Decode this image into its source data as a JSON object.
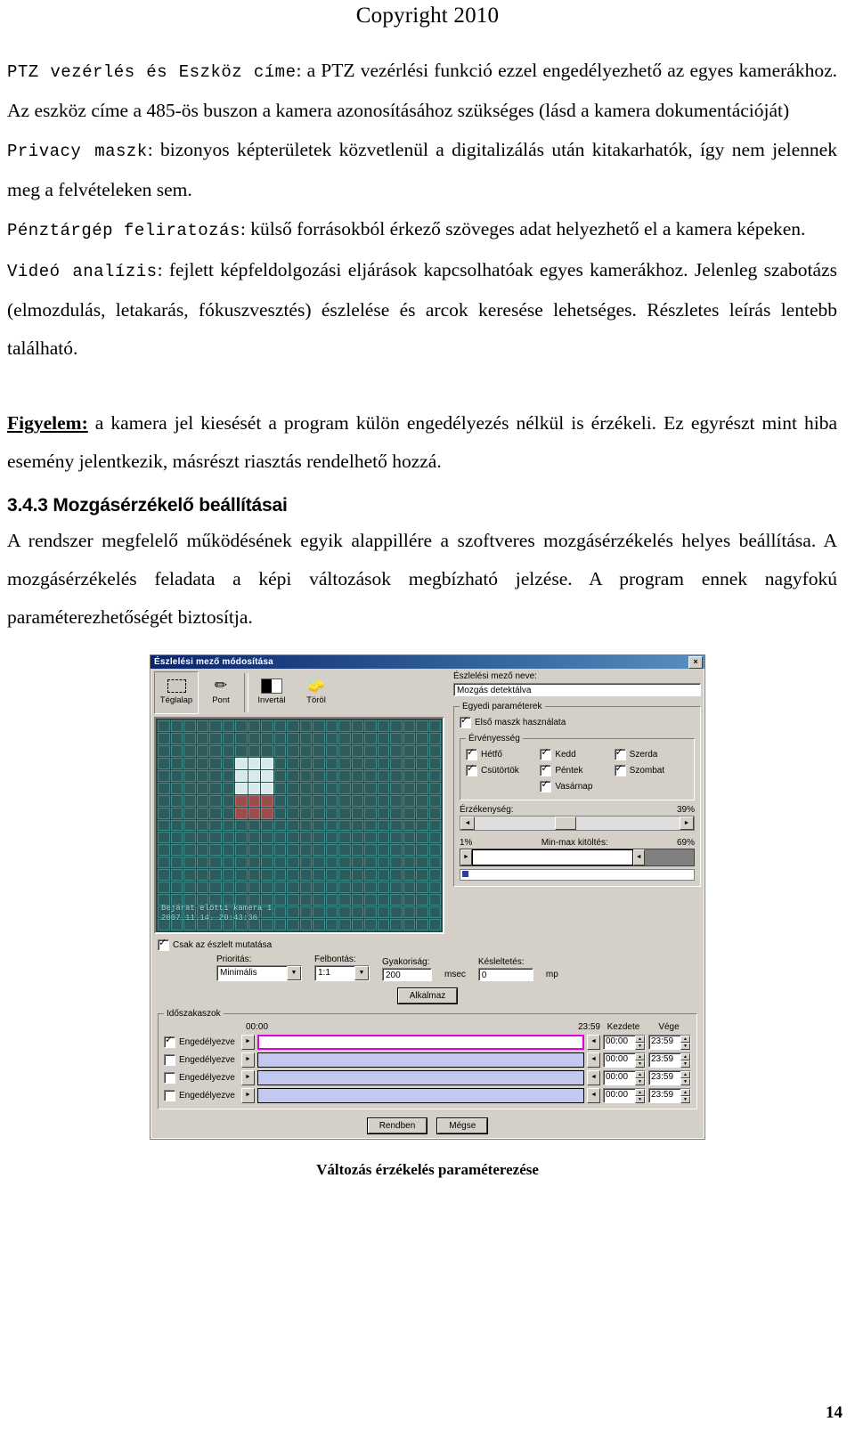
{
  "header": {
    "copyright": "Copyright 2010"
  },
  "page_number": "14",
  "paragraphs": {
    "p1_term": "PTZ vezérlés és Eszköz címe",
    "p1_text": ": a PTZ vezérlési funkció ezzel engedélyezhető az egyes kamerákhoz. Az eszköz címe a 485-ös buszon a kamera azonosításához szükséges (lásd a kamera dokumentációját)",
    "p2_term": "Privacy maszk",
    "p2_text": ": bizonyos képterületek közvetlenül a digitalizálás után kitakarhatók, így nem jelennek meg a felvételeken sem.",
    "p3_term": "Pénztárgép feliratozás",
    "p3_text": ": külső forrásokból érkező szöveges adat helyezhető el a kamera képeken.",
    "p4_term": "Videó analízis",
    "p4_text": ": fejlett képfeldolgozási eljárások kapcsolhatóak egyes kamerákhoz. Jelenleg szabotázs (elmozdulás, letakarás, fókuszvesztés) észlelése és arcok keresése lehetséges. Részletes leírás lentebb található.",
    "p5_term": "Figyelem:",
    "p5_text": " a kamera jel kiesését a program külön engedélyezés nélkül is érzékeli. Ez egyrészt mint hiba esemény jelentkezik, másrészt riasztás rendelhető hozzá.",
    "section_heading": "3.4.3 Mozgásérzékelő beállításai",
    "p6_text": "A rendszer megfelelő működésének egyik alappillére a szoftveres mozgásérzékelés helyes beállítása. A mozgásérzékelés feladata a képi változások megbízható jelzése. A program ennek nagyfokú paraméterezhetőségét biztosítja."
  },
  "dialog": {
    "title": "Észlelési mező módosítása",
    "close_label": "×",
    "toolbar": [
      {
        "label": "Téglalap",
        "icon": "rectangle-icon",
        "selected": true
      },
      {
        "label": "Pont",
        "icon": "pencil-icon",
        "selected": false
      },
      {
        "label": "Invertál",
        "icon": "invert-icon",
        "selected": false
      },
      {
        "label": "Töröl",
        "icon": "eraser-icon",
        "selected": false
      }
    ],
    "mask_osd_line1": "Bejárat előtti kamera 1",
    "mask_osd_line2": "2007.11.14. 20:43:36",
    "field_name_label": "Észlelési mező neve:",
    "field_name_value": "Mozgás detektálva",
    "group_params_label": "Egyedi paraméterek",
    "first_mask_label": "Első maszk használata",
    "first_mask_checked": true,
    "group_validity_label": "Érvényesség",
    "days": [
      {
        "label": "Hétfő",
        "checked": true
      },
      {
        "label": "Kedd",
        "checked": true
      },
      {
        "label": "Szerda",
        "checked": true
      },
      {
        "label": "Csütörtök",
        "checked": true
      },
      {
        "label": "Péntek",
        "checked": true
      },
      {
        "label": "Szombat",
        "checked": true
      },
      {
        "label": "Vasárnap",
        "checked": true
      }
    ],
    "sensitivity_label": "Érzékenység:",
    "sensitivity_value": "39%",
    "minmax_min": "1%",
    "minmax_label": "Min-max kitöltés:",
    "minmax_max": "69%",
    "show_detected_label": "Csak az észlelt mutatása",
    "show_detected_checked": true,
    "priority_label": "Prioritás:",
    "priority_value": "Minimális",
    "resolution_label": "Felbontás:",
    "resolution_value": "1:1",
    "frequency_label": "Gyakoriság:",
    "frequency_value": "200",
    "frequency_unit": "msec",
    "delay_label": "Késleltetés:",
    "delay_value": "0",
    "delay_unit": "mp",
    "apply_label": "Alkalmaz",
    "periods_group_label": "Időszakaszok",
    "periods_time_start": "00:00",
    "periods_time_end": "23:59",
    "periods_col_start": "Kezdete",
    "periods_col_end": "Vége",
    "periods": [
      {
        "label": "Engedélyezve",
        "checked": true,
        "start": "00:00",
        "end": "23:59"
      },
      {
        "label": "Engedélyezve",
        "checked": false,
        "start": "00:00",
        "end": "23:59"
      },
      {
        "label": "Engedélyezve",
        "checked": false,
        "start": "00:00",
        "end": "23:59"
      },
      {
        "label": "Engedélyezve",
        "checked": false,
        "start": "00:00",
        "end": "23:59"
      }
    ],
    "ok_label": "Rendben",
    "cancel_label": "Mégse"
  },
  "figure_caption": "Változás érzékelés paraméterezése"
}
